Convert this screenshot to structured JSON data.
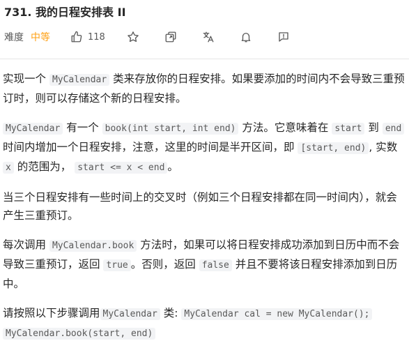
{
  "problem": {
    "title": "731. 我的日程安排表 II",
    "difficulty_label": "难度",
    "difficulty_value": "中等",
    "like_count": "118"
  },
  "icons": {
    "like": "thumbs-up-icon",
    "star": "star-icon",
    "share": "share-icon",
    "translate": "translate-icon",
    "bell": "bell-icon",
    "report": "report-icon"
  },
  "colors": {
    "difficulty": "#ffa116",
    "code_bg": "#f2f3f5",
    "text": "#262626"
  },
  "description": {
    "p1": {
      "t1": "实现一个 ",
      "c1": "MyCalendar",
      "t2": " 类来存放你的日程安排。如果要添加的时间内不会导致三重预订时，则可以存储这个新的日程安排。"
    },
    "p2": {
      "c1": "MyCalendar",
      "t1": " 有一个 ",
      "c2": "book(int start, int end)",
      "t2": " 方法。它意味着在 ",
      "c3": "start",
      "t3": " 到 ",
      "c4": "end",
      "t4": " 时间内增加一个日程安排，注意，这里的时间是半开区间，即 ",
      "c5": "[start, end)",
      "t5": ", 实数 ",
      "c6": "x",
      "t6": " 的范围为，  ",
      "c7": "start <= x < end",
      "t7": "。"
    },
    "p3": {
      "t1": "当三个日程安排有一些时间上的交叉时（例如三个日程安排都在同一时间内），就会产生三重预订。"
    },
    "p4": {
      "t1": "每次调用 ",
      "c1": "MyCalendar.book",
      "t2": " 方法时，如果可以将日程安排成功添加到日历中而不会导致三重预订，返回 ",
      "c2": "true",
      "t3": "。否则，返回 ",
      "c3": "false",
      "t4": " 并且不要将该日程安排添加到日历中。"
    },
    "p5": {
      "t1": "请按照以下步骤调用",
      "c1": "MyCalendar",
      "t2": " 类: ",
      "c2": "MyCalendar cal = new MyCalendar();",
      "t3": " ",
      "c3": "MyCalendar.book(start, end)"
    }
  }
}
